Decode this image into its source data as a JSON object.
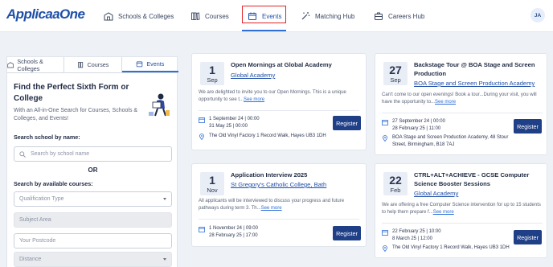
{
  "header": {
    "logo": {
      "text_main": "Applica",
      "text_accent": "aOne"
    },
    "nav": [
      {
        "label": "Schools & Colleges",
        "icon": "school-icon"
      },
      {
        "label": "Courses",
        "icon": "books-icon"
      },
      {
        "label": "Events",
        "icon": "calendar-icon",
        "active": true
      },
      {
        "label": "Matching Hub",
        "icon": "magic-wand-icon"
      },
      {
        "label": "Careers Hub",
        "icon": "briefcase-icon"
      }
    ],
    "avatar_initials": "JA"
  },
  "left_panel": {
    "tabs": [
      {
        "label": "Schools & Colleges",
        "icon": "school-icon"
      },
      {
        "label": "Courses",
        "icon": "books-icon"
      },
      {
        "label": "Events",
        "icon": "calendar-icon",
        "active": true
      }
    ],
    "title": "Find the Perfect Sixth Form or College",
    "subtitle": "With an All-in-One Search for Courses, Schools & Colleges, and Events!",
    "search_by_name_label": "Search school by name:",
    "search_placeholder": "Search by school name",
    "or_text": "OR",
    "search_by_courses_label": "Search by available courses:",
    "qualification_placeholder": "Qualification Type",
    "subject_placeholder": "Subject Area",
    "postcode_placeholder": "Your Postcode",
    "distance_placeholder": "Distance"
  },
  "events": [
    {
      "day": "1",
      "month": "Sep",
      "title": "Open Mornings at Global Academy",
      "venue": "Global Academy",
      "description": "We are delighted to invite you to our Open Mornings. This is a unique opportunity to see t...",
      "see_more": "See more",
      "date_start": "1 September 24 | 00:00",
      "date_end": "31 May 25 | 00:00",
      "address": "The Old Vinyl Factory 1 Record Walk, Hayes UB3 1DH",
      "register_label": "Register"
    },
    {
      "day": "27",
      "month": "Sep",
      "title": "Backstage Tour @ BOA Stage and Screen Production",
      "venue": "BOA Stage and Screen Production Academy",
      "description": "Can't come to our open evenings! Book a tour...During your visit, you will have the opportunity to...",
      "see_more": "See more",
      "date_start": "27 September 24 | 00:00",
      "date_end": "28 February 25 | 11:00",
      "address": "BOA Stage and Screen Production Academy, 48 Stour Street, Birmingham, B18 7AJ",
      "register_label": "Register"
    },
    {
      "day": "1",
      "month": "Nov",
      "title": "Application Interview 2025",
      "venue": "St Gregory's Catholic College, Bath",
      "description": "All applicants will be interviewed to discuss your progress and future pathways during term 3. Th...",
      "see_more": "See more",
      "date_start": "1 November 24 | 09:00",
      "date_end": "28 February 25 | 17:00",
      "address": "",
      "register_label": "Register"
    },
    {
      "day": "22",
      "month": "Feb",
      "title": "CTRL+ALT+ACHIEVE - GCSE Computer Science Booster Sessions",
      "venue": "Global Academy",
      "description": "We are offering a free Computer Science intervention for up to 15 students to help them prepare f...",
      "see_more": "See more",
      "date_start": "22 February 25 | 10:00",
      "date_end": "8 March 25 | 12:00",
      "address": "The Old Vinyl Factory 1 Record Walk, Hayes UB3 1DH",
      "register_label": "Register"
    }
  ],
  "colors": {
    "brand": "#1f4fa8",
    "accent_blue": "#2f6fd6",
    "button": "#1f3f86",
    "highlight_box": "#e02424",
    "page_bg": "#eef1f6"
  }
}
